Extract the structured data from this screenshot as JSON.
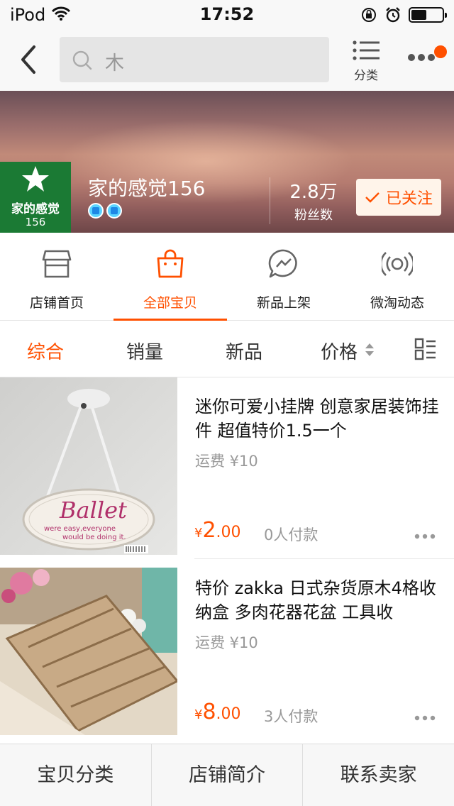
{
  "status_bar": {
    "carrier": "iPod",
    "time": "17:52"
  },
  "nav": {
    "search_placeholder": "木",
    "category_label": "分类"
  },
  "shop": {
    "logo_text": "家的感觉",
    "logo_number": "156",
    "name": "家的感觉156",
    "fans_count": "2.8万",
    "fans_label": "粉丝数",
    "follow_label": "已关注"
  },
  "tabs": [
    {
      "label": "店铺首页",
      "icon": "store-icon"
    },
    {
      "label": "全部宝贝",
      "icon": "bag-icon",
      "active": true
    },
    {
      "label": "新品上架",
      "icon": "chat-bolt-icon"
    },
    {
      "label": "微淘动态",
      "icon": "broadcast-icon"
    }
  ],
  "sort": {
    "items": [
      "综合",
      "销量",
      "新品",
      "价格"
    ],
    "active": "综合"
  },
  "products": [
    {
      "title": "迷你可爱小挂牌 创意家居装饰挂件 超值特价1.5一个",
      "shipping": "运费 ¥10",
      "price_symbol": "¥",
      "price_int": "2",
      "price_dec": ".00",
      "sold": "0人付款",
      "image_text": "Ballet",
      "image_caption1": "were easy,everyone",
      "image_caption2": "would be doing it."
    },
    {
      "title": "特价 zakka 日式杂货原木4格收纳盒 多肉花器花盆 工具收",
      "shipping": "运费 ¥10",
      "price_symbol": "¥",
      "price_int": "8",
      "price_dec": ".00",
      "sold": "3人付款"
    }
  ],
  "bottom_bar": [
    "宝贝分类",
    "店铺简介",
    "联系卖家"
  ],
  "colors": {
    "accent": "#ff5000",
    "shop_logo_bg": "#1b7a34"
  }
}
